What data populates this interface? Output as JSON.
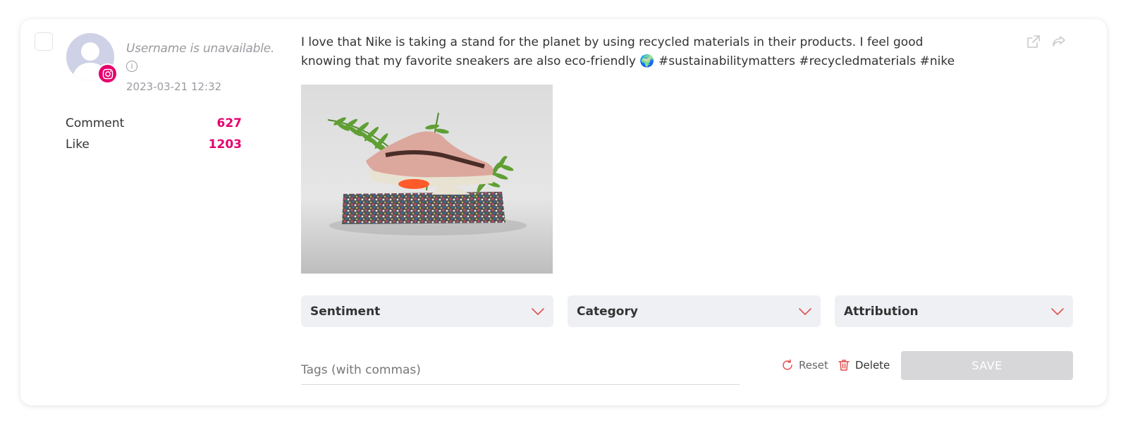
{
  "post": {
    "username": "Username is unavailable.",
    "date": "2023-03-21 12:32",
    "network": "instagram",
    "text": "I love that Nike is taking a stand for the planet by using recycled materials in their products. I feel good knowing that my favorite sneakers are also eco-friendly 🌍 #sustainabilitymatters #recycledmaterials #nike"
  },
  "stats": [
    {
      "label": "Comment",
      "value": "627"
    },
    {
      "label": "Like",
      "value": "1203"
    }
  ],
  "dropdowns": {
    "sentiment": "Sentiment",
    "category": "Category",
    "attribution": "Attribution"
  },
  "tags": {
    "placeholder": "Tags (with commas)"
  },
  "actions": {
    "reset": "Reset",
    "delete": "Delete",
    "save": "SAVE"
  },
  "colors": {
    "accent": "#e5006d",
    "muted": "#9a9aa0",
    "chevron": "#e05050"
  },
  "icons": {
    "top": [
      "external-link-icon",
      "share-icon"
    ],
    "reset": "refresh-icon",
    "delete": "trash-icon"
  }
}
